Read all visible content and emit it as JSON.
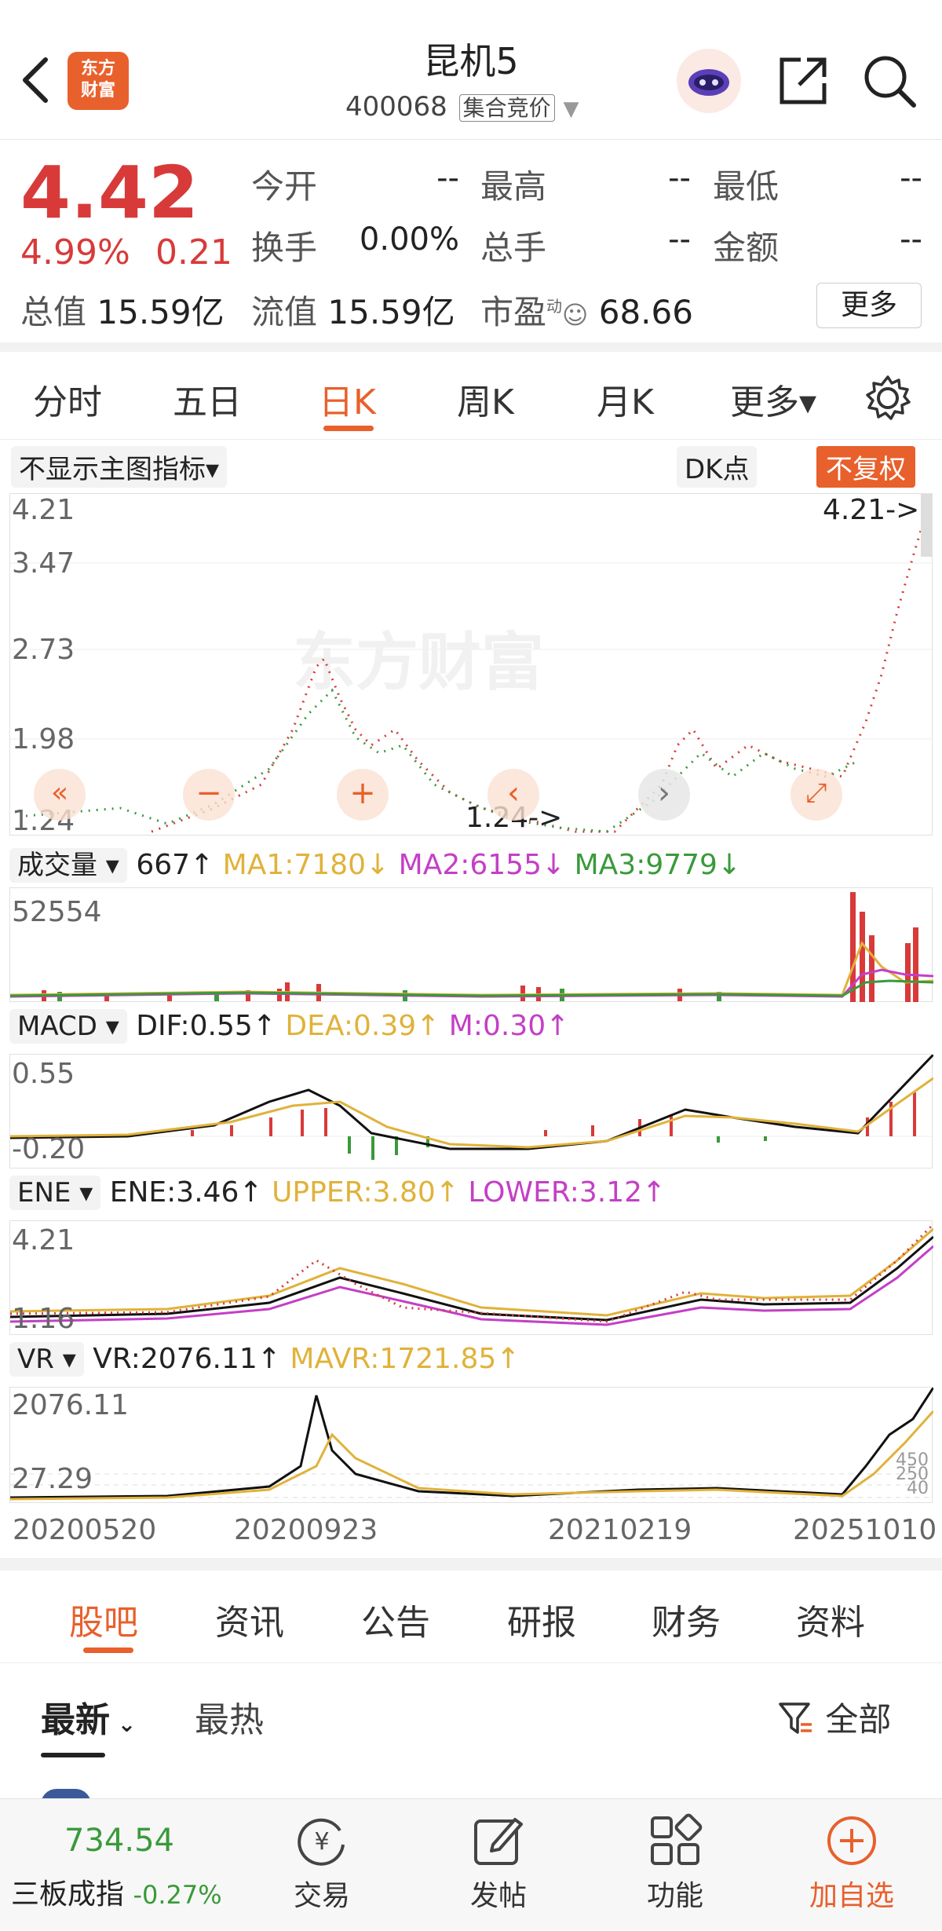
{
  "header": {
    "title": "昆机5",
    "code": "400068",
    "session_badge": "集合竞价",
    "logo_text_1": "东方",
    "logo_text_2": "财富"
  },
  "quote": {
    "price": "4.42",
    "change_pct": "4.99%",
    "change": "0.21",
    "fields": [
      {
        "label": "今开",
        "value": "--"
      },
      {
        "label": "最高",
        "value": "--"
      },
      {
        "label": "最低",
        "value": "--"
      },
      {
        "label": "换手",
        "value": "0.00%"
      },
      {
        "label": "总手",
        "value": "--"
      },
      {
        "label": "金额",
        "value": "--"
      }
    ],
    "market_cap_label": "总值",
    "market_cap": "15.59亿",
    "float_cap_label": "流值",
    "float_cap": "15.59亿",
    "pe_label": "市盈",
    "pe_sup": "动",
    "pe": "68.66",
    "more_button": "更多"
  },
  "chart_tabs": [
    "分时",
    "五日",
    "日K",
    "周K",
    "月K",
    "更多▾"
  ],
  "active_chart_tab": "日K",
  "chart_toolbar": {
    "indicator_select": "不显示主图指标▾",
    "dk_button": "DK点",
    "adjust_button": "不复权"
  },
  "kline": {
    "y_ticks": [
      "4.21",
      "3.47",
      "2.73",
      "1.98",
      "1.24"
    ],
    "max_marker": "4.21->",
    "min_marker": "1.24->",
    "watermark": "东方财富"
  },
  "volume": {
    "selector": "成交量",
    "value": "667↑",
    "ma1": "MA1:7180↓",
    "ma2": "MA2:6155↓",
    "ma3": "MA3:9779↓",
    "y_max": "52554"
  },
  "macd": {
    "selector": "MACD",
    "dif": "DIF:0.55↑",
    "dea": "DEA:0.39↑",
    "m": "M:0.30↑",
    "y_top": "0.55",
    "y_bottom": "-0.20"
  },
  "ene": {
    "selector": "ENE",
    "ene": "ENE:3.46↑",
    "upper": "UPPER:3.80↑",
    "lower": "LOWER:3.12↑",
    "y_top": "4.21",
    "y_bottom": "1.16"
  },
  "vr": {
    "selector": "VR",
    "vr": "VR:2076.11↑",
    "mavr": "MAVR:1721.85↑",
    "y_top": "2076.11",
    "y_bottom": "27.29",
    "right_marks": [
      "450",
      "250",
      "40"
    ]
  },
  "x_dates": [
    "20200520",
    "20200923",
    "20210219",
    "20251010"
  ],
  "content_tabs": [
    "股吧",
    "资讯",
    "公告",
    "研报",
    "财务",
    "资料"
  ],
  "active_content_tab": "股吧",
  "feed": {
    "sort_latest": "最新",
    "sort_hot": "最热",
    "filter_all": "全部"
  },
  "bottom_nav": {
    "index_value": "734.54",
    "index_name": "三板成指",
    "index_change": "-0.27%",
    "items": [
      "交易",
      "发帖",
      "功能",
      "加自选"
    ]
  },
  "colors": {
    "up_red": "#d83a3a",
    "accent_orange": "#e8602c",
    "ma_gold": "#e0b23a",
    "ma_purple": "#c43fc6",
    "ma_green": "#3a9a3a"
  }
}
